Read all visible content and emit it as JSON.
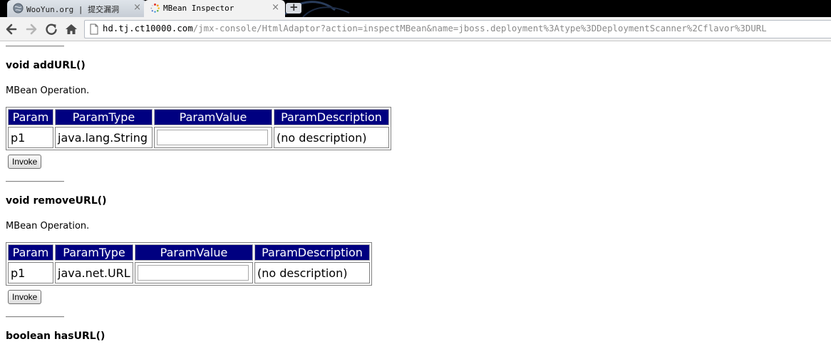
{
  "browser": {
    "tabs": [
      {
        "title": "WooYun.org | 提交漏洞",
        "active": false,
        "close": "×"
      },
      {
        "title": "MBean Inspector",
        "active": true,
        "close": "×"
      }
    ],
    "new_tab": "+",
    "url_host": "hd.tj.ct10000.com",
    "url_path": "/jmx-console/HtmlAdaptor?action=inspectMBean&name=jboss.deployment%3Atype%3DDeploymentScanner%2Cflavor%3DURL"
  },
  "operations": [
    {
      "signature": "void addURL()",
      "description": "MBean Operation.",
      "headers": [
        "Param",
        "ParamType",
        "ParamValue",
        "ParamDescription"
      ],
      "rows": [
        {
          "name": "p1",
          "type": "java.lang.String",
          "value": "",
          "description": "(no description)"
        }
      ],
      "invoke_label": "Invoke"
    },
    {
      "signature": "void removeURL()",
      "description": "MBean Operation.",
      "headers": [
        "Param",
        "ParamType",
        "ParamValue",
        "ParamDescription"
      ],
      "rows": [
        {
          "name": "p1",
          "type": "java.net.URL",
          "value": "",
          "description": "(no description)"
        }
      ],
      "invoke_label": "Invoke"
    },
    {
      "signature": "boolean hasURL()"
    }
  ],
  "colors": {
    "header_bg": "#000080",
    "header_fg": "#ffffff"
  },
  "icons": [
    "back-icon",
    "forward-icon",
    "reload-icon",
    "home-icon",
    "page-icon",
    "globe-favicon",
    "loading-favicon"
  ]
}
